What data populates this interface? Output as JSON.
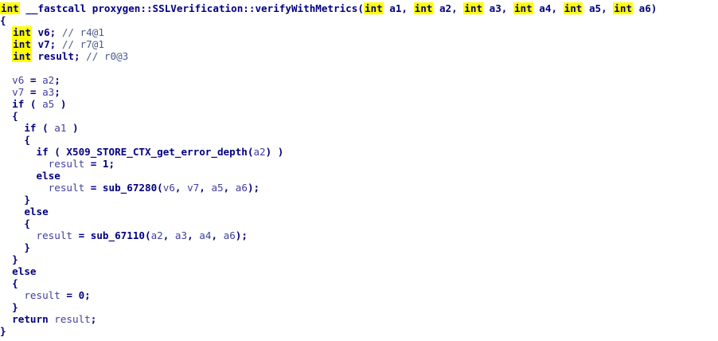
{
  "code_lines": [
    {
      "indent": "",
      "tokens": [
        {
          "t": "int",
          "c": "type",
          "name": "type-int"
        },
        {
          "t": " __fastcall proxygen::SSLVerification::verifyWithMetrics(",
          "c": "blue"
        },
        {
          "t": "int",
          "c": "type",
          "name": "type-int"
        },
        {
          "t": " a1, ",
          "c": "blue"
        },
        {
          "t": "int",
          "c": "type",
          "name": "type-int"
        },
        {
          "t": " a2, ",
          "c": "blue"
        },
        {
          "t": "int",
          "c": "type",
          "name": "type-int"
        },
        {
          "t": " a3, ",
          "c": "blue"
        },
        {
          "t": "int",
          "c": "type",
          "name": "type-int"
        },
        {
          "t": " a4, ",
          "c": "blue"
        },
        {
          "t": "int",
          "c": "type",
          "name": "type-int"
        },
        {
          "t": " a5, ",
          "c": "blue"
        },
        {
          "t": "int",
          "c": "type",
          "name": "type-int"
        },
        {
          "t": " a6)",
          "c": "blue"
        }
      ]
    },
    {
      "indent": "",
      "tokens": [
        {
          "t": "{",
          "c": "blue"
        }
      ]
    },
    {
      "indent": "  ",
      "tokens": [
        {
          "t": "int",
          "c": "type",
          "name": "type-int"
        },
        {
          "t": " v6; ",
          "c": "blue"
        },
        {
          "t": "// r4@1",
          "c": "cmt"
        }
      ]
    },
    {
      "indent": "  ",
      "tokens": [
        {
          "t": "int",
          "c": "type",
          "name": "type-int"
        },
        {
          "t": " v7; ",
          "c": "blue"
        },
        {
          "t": "// r7@1",
          "c": "cmt"
        }
      ]
    },
    {
      "indent": "  ",
      "tokens": [
        {
          "t": "int",
          "c": "type",
          "name": "type-int"
        },
        {
          "t": " result; ",
          "c": "blue"
        },
        {
          "t": "// r0@3",
          "c": "cmt"
        }
      ]
    },
    {
      "indent": "",
      "tokens": []
    },
    {
      "indent": "  ",
      "tokens": [
        {
          "t": "v6",
          "c": "var-light"
        },
        {
          "t": " = ",
          "c": "blue"
        },
        {
          "t": "a2",
          "c": "var-light"
        },
        {
          "t": ";",
          "c": "blue"
        }
      ]
    },
    {
      "indent": "  ",
      "tokens": [
        {
          "t": "v7",
          "c": "var-light"
        },
        {
          "t": " = ",
          "c": "blue"
        },
        {
          "t": "a3",
          "c": "var-light"
        },
        {
          "t": ";",
          "c": "blue"
        }
      ]
    },
    {
      "indent": "  ",
      "tokens": [
        {
          "t": "if ( ",
          "c": "blue"
        },
        {
          "t": "a5",
          "c": "var-light"
        },
        {
          "t": " )",
          "c": "blue"
        }
      ]
    },
    {
      "indent": "  ",
      "tokens": [
        {
          "t": "{",
          "c": "blue"
        }
      ]
    },
    {
      "indent": "    ",
      "tokens": [
        {
          "t": "if ( ",
          "c": "blue"
        },
        {
          "t": "a1",
          "c": "var-light"
        },
        {
          "t": " )",
          "c": "blue"
        }
      ]
    },
    {
      "indent": "    ",
      "tokens": [
        {
          "t": "{",
          "c": "blue"
        }
      ]
    },
    {
      "indent": "      ",
      "tokens": [
        {
          "t": "if ( X509_STORE_CTX_get_error_depth(",
          "c": "blue"
        },
        {
          "t": "a2",
          "c": "var-light"
        },
        {
          "t": ") )",
          "c": "blue"
        }
      ]
    },
    {
      "indent": "        ",
      "tokens": [
        {
          "t": "result",
          "c": "var-light"
        },
        {
          "t": " = 1;",
          "c": "blue"
        }
      ]
    },
    {
      "indent": "      ",
      "tokens": [
        {
          "t": "else",
          "c": "blue"
        }
      ]
    },
    {
      "indent": "        ",
      "tokens": [
        {
          "t": "result",
          "c": "var-light"
        },
        {
          "t": " = sub_67280(",
          "c": "blue"
        },
        {
          "t": "v6",
          "c": "var-light"
        },
        {
          "t": ", ",
          "c": "blue"
        },
        {
          "t": "v7",
          "c": "var-light"
        },
        {
          "t": ", ",
          "c": "blue"
        },
        {
          "t": "a5",
          "c": "var-light"
        },
        {
          "t": ", ",
          "c": "blue"
        },
        {
          "t": "a6",
          "c": "var-light"
        },
        {
          "t": ");",
          "c": "blue"
        }
      ]
    },
    {
      "indent": "    ",
      "tokens": [
        {
          "t": "}",
          "c": "blue"
        }
      ]
    },
    {
      "indent": "    ",
      "tokens": [
        {
          "t": "else",
          "c": "blue"
        }
      ]
    },
    {
      "indent": "    ",
      "tokens": [
        {
          "t": "{",
          "c": "blue"
        }
      ]
    },
    {
      "indent": "      ",
      "tokens": [
        {
          "t": "result",
          "c": "var-light"
        },
        {
          "t": " = sub_67110(",
          "c": "blue"
        },
        {
          "t": "a2",
          "c": "var-light"
        },
        {
          "t": ", ",
          "c": "blue"
        },
        {
          "t": "a3",
          "c": "var-light"
        },
        {
          "t": ", ",
          "c": "blue"
        },
        {
          "t": "a4",
          "c": "var-light"
        },
        {
          "t": ", ",
          "c": "blue"
        },
        {
          "t": "a6",
          "c": "var-light"
        },
        {
          "t": ");",
          "c": "blue"
        }
      ]
    },
    {
      "indent": "    ",
      "tokens": [
        {
          "t": "}",
          "c": "blue"
        }
      ]
    },
    {
      "indent": "  ",
      "tokens": [
        {
          "t": "}",
          "c": "blue"
        }
      ]
    },
    {
      "indent": "  ",
      "tokens": [
        {
          "t": "else",
          "c": "blue"
        }
      ]
    },
    {
      "indent": "  ",
      "tokens": [
        {
          "t": "{",
          "c": "blue"
        }
      ]
    },
    {
      "indent": "    ",
      "tokens": [
        {
          "t": "result",
          "c": "var-light"
        },
        {
          "t": " = 0;",
          "c": "blue"
        }
      ]
    },
    {
      "indent": "  ",
      "tokens": [
        {
          "t": "}",
          "c": "blue"
        }
      ]
    },
    {
      "indent": "  ",
      "tokens": [
        {
          "t": "return ",
          "c": "blue"
        },
        {
          "t": "result",
          "c": "var-light"
        },
        {
          "t": ";",
          "c": "blue"
        }
      ]
    },
    {
      "indent": "",
      "tokens": [
        {
          "t": "}",
          "c": "blue"
        }
      ]
    }
  ],
  "colors": {
    "background": "#ffffff",
    "text": "#000080",
    "variable": "#4040a0",
    "comment": "#4b5b88",
    "type_highlight": "#ffff00"
  }
}
